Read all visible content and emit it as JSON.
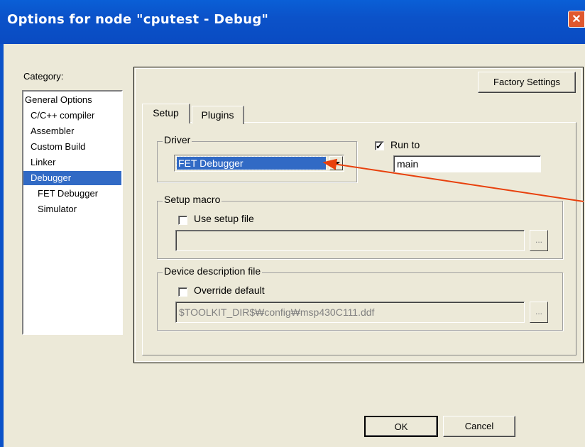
{
  "window": {
    "title": "Options for node \"cputest - Debug\"",
    "close_label": "✕"
  },
  "category": {
    "label": "Category:",
    "items": [
      {
        "label": "General Options"
      },
      {
        "label": "C/C++ compiler"
      },
      {
        "label": "Assembler"
      },
      {
        "label": "Custom Build"
      },
      {
        "label": "Linker"
      },
      {
        "label": "Debugger",
        "selected": true
      },
      {
        "label": "FET Debugger"
      },
      {
        "label": "Simulator"
      }
    ]
  },
  "buttons": {
    "factory_settings": "Factory Settings",
    "ok": "OK",
    "cancel": "Cancel"
  },
  "tabs": [
    {
      "label": "Setup",
      "active": true
    },
    {
      "label": "Plugins"
    }
  ],
  "setup": {
    "driver": {
      "legend": "Driver",
      "selected": "FET Debugger"
    },
    "run_to": {
      "label": "Run to",
      "checked": true,
      "value": "main"
    },
    "setup_macro": {
      "legend": "Setup macro",
      "checkbox_label": "Use setup file",
      "checked": false,
      "path": "",
      "browse_label": "..."
    },
    "device_description": {
      "legend": "Device description file",
      "checkbox_label": "Override default",
      "checked": false,
      "path": "$TOOLKIT_DIR$₩config₩msp430C111.ddf",
      "browse_label": "..."
    }
  },
  "annotation": {
    "arrow_color": "#e8400c"
  },
  "colors": {
    "title_bar": "#0b52c9",
    "selection": "#316ac5",
    "dialog_bg": "#ece9d8"
  }
}
